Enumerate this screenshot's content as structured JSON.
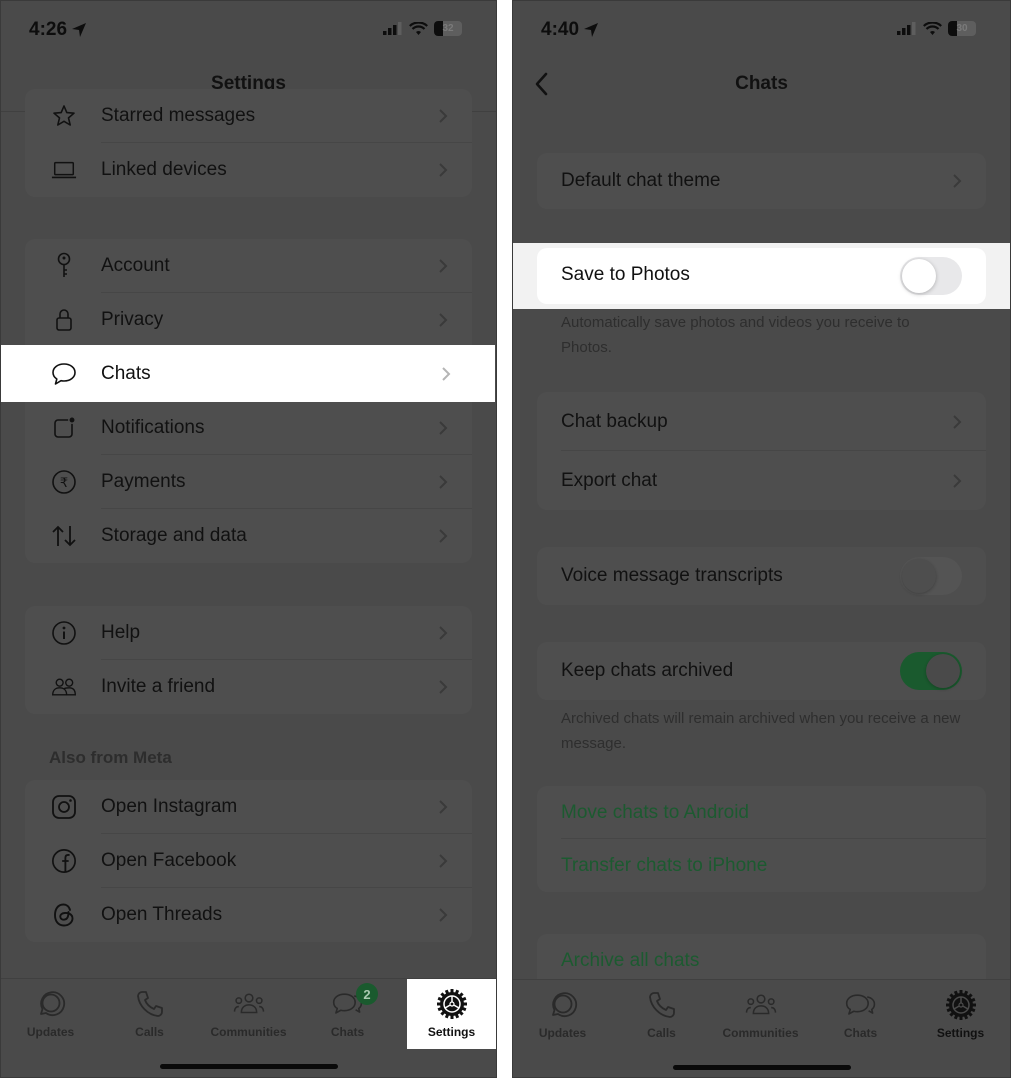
{
  "left": {
    "status": {
      "time": "4:26",
      "battery": "32"
    },
    "title": "Settings",
    "groups": [
      {
        "items": [
          {
            "label": "Starred messages",
            "icon": "star-icon"
          },
          {
            "label": "Linked devices",
            "icon": "laptop-icon"
          }
        ]
      },
      {
        "items": [
          {
            "label": "Account",
            "icon": "key-icon"
          },
          {
            "label": "Privacy",
            "icon": "lock-icon"
          },
          {
            "label": "Chats",
            "icon": "chat-bubble-icon",
            "highlighted": true
          },
          {
            "label": "Notifications",
            "icon": "notification-icon"
          },
          {
            "label": "Payments",
            "icon": "rupee-icon"
          },
          {
            "label": "Storage and data",
            "icon": "arrows-updown-icon"
          }
        ]
      },
      {
        "items": [
          {
            "label": "Help",
            "icon": "info-icon"
          },
          {
            "label": "Invite a friend",
            "icon": "people-icon"
          }
        ]
      }
    ],
    "meta_section_label": "Also from Meta",
    "meta_items": [
      {
        "label": "Open Instagram",
        "icon": "instagram-icon"
      },
      {
        "label": "Open Facebook",
        "icon": "facebook-icon"
      },
      {
        "label": "Open Threads",
        "icon": "threads-icon"
      }
    ],
    "tabs": [
      {
        "label": "Updates"
      },
      {
        "label": "Calls"
      },
      {
        "label": "Communities"
      },
      {
        "label": "Chats",
        "badge": "2"
      },
      {
        "label": "Settings",
        "active": true
      }
    ]
  },
  "right": {
    "status": {
      "time": "4:40",
      "battery": "30"
    },
    "title": "Chats",
    "default_chat_theme": "Default chat theme",
    "save_to_photos": {
      "label": "Save to Photos",
      "on": false
    },
    "save_to_photos_note": "Automatically save photos and videos you receive to Photos.",
    "chat_backup": "Chat backup",
    "export_chat": "Export chat",
    "voice_transcripts": {
      "label": "Voice message transcripts",
      "on": false
    },
    "keep_archived": {
      "label": "Keep chats archived",
      "on": true
    },
    "keep_archived_note": "Archived chats will remain archived when you receive a new message.",
    "move_android": "Move chats to Android",
    "transfer_iphone": "Transfer chats to iPhone",
    "archive_all": "Archive all chats",
    "tabs": [
      {
        "label": "Updates"
      },
      {
        "label": "Calls"
      },
      {
        "label": "Communities"
      },
      {
        "label": "Chats"
      },
      {
        "label": "Settings",
        "active": true
      }
    ]
  },
  "colors": {
    "accent_green": "#1a5a2e",
    "overlay": "#4a4a4a",
    "highlight": "#ffffff"
  }
}
